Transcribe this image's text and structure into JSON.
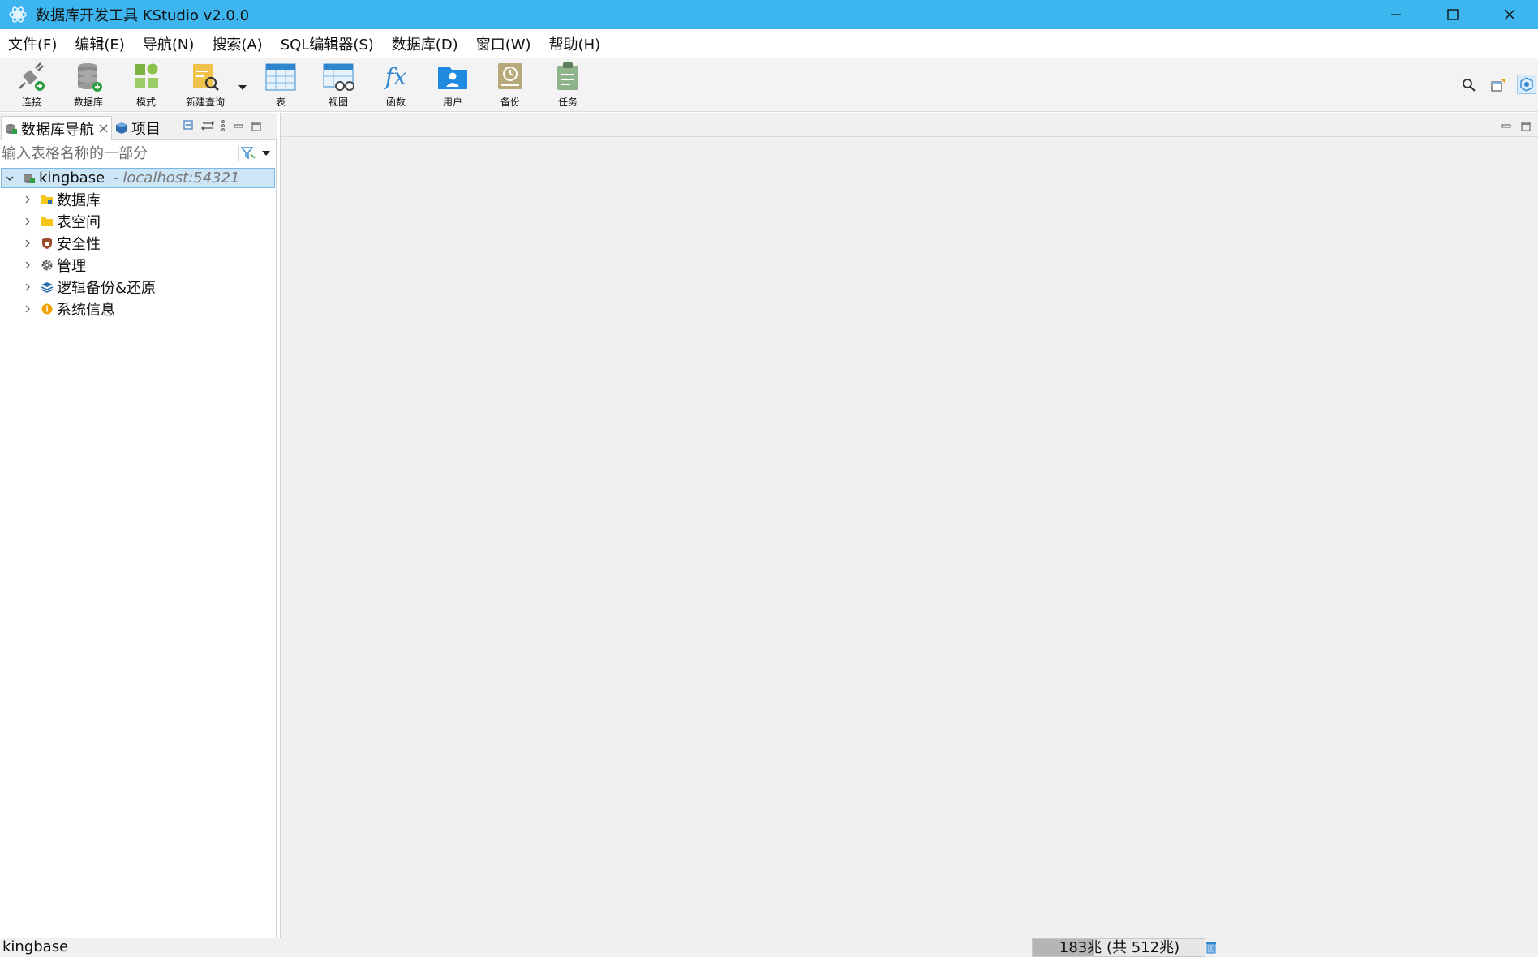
{
  "window": {
    "title": "数据库开发工具 KStudio v2.0.0"
  },
  "menu": [
    "文件(F)",
    "编辑(E)",
    "导航(N)",
    "搜索(A)",
    "SQL编辑器(S)",
    "数据库(D)",
    "窗口(W)",
    "帮助(H)"
  ],
  "toolbar": {
    "connect": "连接",
    "database": "数据库",
    "schema": "模式",
    "new_query": "新建查询",
    "table": "表",
    "view": "视图",
    "function": "函数",
    "user": "用户",
    "backup": "备份",
    "task": "任务"
  },
  "left_panel": {
    "tab_navigator": "数据库导航",
    "tab_projects": "项目",
    "filter_placeholder": "输入表格名称的一部分",
    "tree": {
      "root_label": "kingbase",
      "root_host": "- localhost:54321",
      "children": [
        "数据库",
        "表空间",
        "安全性",
        "管理",
        "逻辑备份&还原",
        "系统信息"
      ]
    }
  },
  "status": {
    "selection": "kingbase",
    "heap_text": "183兆 (共 512兆)",
    "heap_used_fraction": 0.357
  },
  "colors": {
    "titlebar": "#3db5ef",
    "selection": "#cce6f8",
    "editor_bg": "#f0f0f0"
  }
}
